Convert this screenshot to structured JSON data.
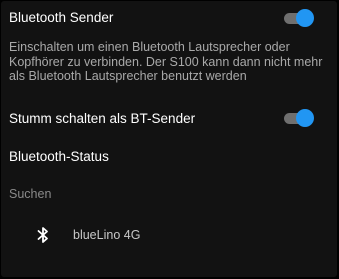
{
  "bluetooth_sender": {
    "title": "Bluetooth Sender",
    "description": "Einschalten um einen Bluetooth Lautsprecher oder Kopfhörer zu verbinden. Der S100 kann dann nicht mehr als Bluetooth Lautsprecher benutzt werden",
    "enabled": true
  },
  "mute_as_sender": {
    "title": "Stumm schalten als BT-Sender",
    "enabled": true
  },
  "status": {
    "title": "Bluetooth-Status",
    "state_label": "Suchen"
  },
  "devices": [
    {
      "icon": "bluetooth-icon",
      "name": "blueLino 4G"
    }
  ],
  "colors": {
    "background": "#121212",
    "accent": "#2196f3",
    "switch_track": "#6f6f6f",
    "secondary_text": "#a9a9a9"
  }
}
